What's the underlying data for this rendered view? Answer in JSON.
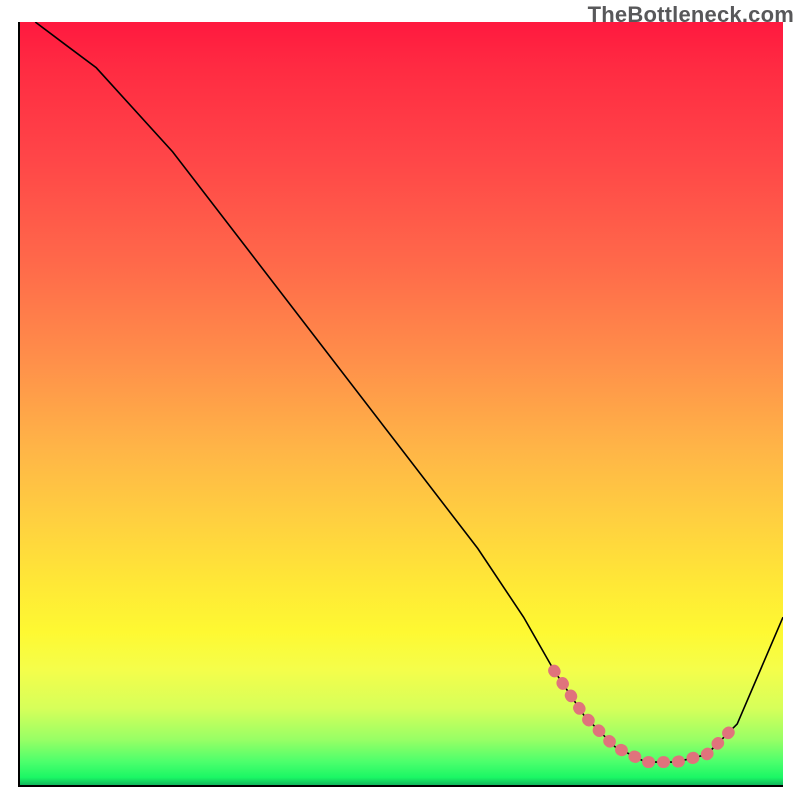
{
  "watermark": "TheBottleneck.com",
  "chart_data": {
    "type": "line",
    "title": "",
    "xlabel": "",
    "ylabel": "",
    "xlim": [
      0,
      100
    ],
    "ylim": [
      0,
      100
    ],
    "grid": false,
    "legend": false,
    "series": [
      {
        "name": "bottleneck-curve",
        "x": [
          2,
          6,
          10,
          20,
          30,
          40,
          50,
          60,
          66,
          70,
          74,
          78,
          82,
          86,
          90,
          94,
          100
        ],
        "y": [
          100,
          97,
          94,
          83,
          70,
          57,
          44,
          31,
          22,
          15,
          9,
          5,
          3,
          3,
          4,
          8,
          22
        ]
      },
      {
        "name": "optimal-range-highlight",
        "x": [
          70,
          74,
          78,
          82,
          86,
          90,
          94
        ],
        "y": [
          15,
          9,
          5,
          3,
          3,
          4,
          8
        ]
      }
    ],
    "background_gradient": {
      "direction": "top-to-bottom",
      "stops": [
        {
          "pos": 0,
          "color": "#ff193f"
        },
        {
          "pos": 50,
          "color": "#ff9a49"
        },
        {
          "pos": 80,
          "color": "#fef932"
        },
        {
          "pos": 100,
          "color": "#0fb85b"
        }
      ]
    }
  }
}
